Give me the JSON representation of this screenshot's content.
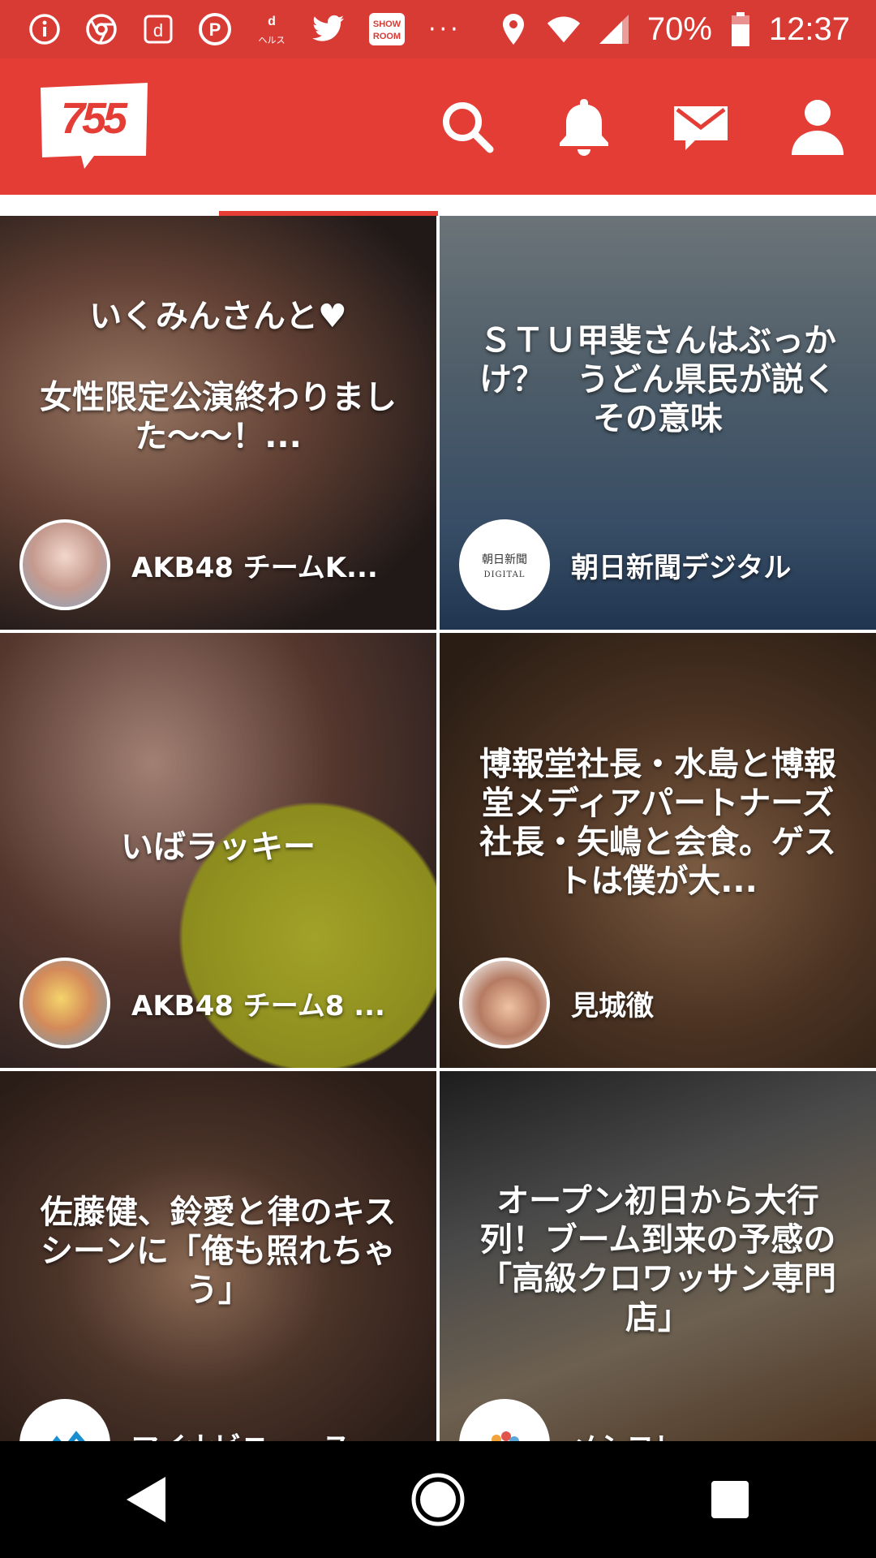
{
  "status_bar": {
    "icons": [
      "info-icon",
      "chrome-icon",
      "d-app-icon",
      "p-app-icon",
      "d-health-icon",
      "twitter-icon",
      "showroom-icon",
      "more-dots-icon",
      "location-icon",
      "wifi-icon",
      "signal-icon"
    ],
    "showroom_label": "SHOW ROOM",
    "dots": "···",
    "battery": "70%",
    "time": "12:37"
  },
  "header": {
    "logo_text": "755",
    "icons": [
      "search-icon",
      "bell-icon",
      "mail-icon",
      "profile-icon"
    ]
  },
  "tabs": {
    "active_index": 1
  },
  "cards": [
    {
      "title_line1": "いくみんさんと♥",
      "title": "女性限定公演終わりました〜〜！...",
      "author": "AKB48 チームK...",
      "avatar": "avatar-akb48-k"
    },
    {
      "title": "ＳＴＵ甲斐さんはぶっかけ？　うどん県民が説くその意味",
      "author": "朝日新聞デジタル",
      "avatar_text_top": "朝日新聞",
      "avatar_text_bottom": "DIGITAL"
    },
    {
      "title": "いばラッキー",
      "author": "AKB48 チーム8 ...",
      "avatar": "avatar-akb48-8"
    },
    {
      "title": "博報堂社長・水島と博報堂メディアパートナーズ社長・矢嶋と会食。ゲストは僕が大...",
      "author": "見城徹",
      "avatar": "avatar-kenjo"
    },
    {
      "title": "佐藤健、鈴愛と律のキスシーンに「俺も照れちゃう」",
      "author": "マイナビニュース",
      "avatar": "avatar-mynavi"
    },
    {
      "title": "オープン初日から大行列！ブーム到来の予感の「高級クロワッサン専門店」",
      "author": "メシコレ",
      "avatar": "avatar-meshicolle"
    }
  ],
  "nav": {
    "icons": [
      "back-icon",
      "home-icon",
      "recents-icon"
    ]
  },
  "colors": {
    "brand": "#e33d36",
    "status": "#d83a34"
  }
}
